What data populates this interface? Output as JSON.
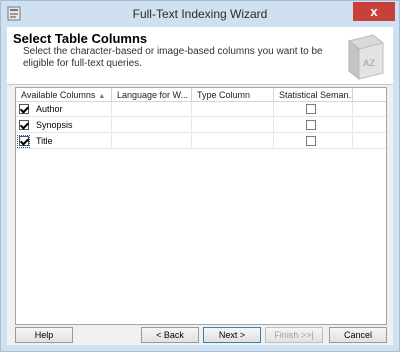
{
  "window": {
    "title": "Full-Text Indexing Wizard",
    "close_glyph": "x"
  },
  "header": {
    "title": "Select Table Columns",
    "subtitle": "Select the character-based or image-based columns you want to be eligible for full-text queries.",
    "graphic_letters": "AZ"
  },
  "grid": {
    "columns": [
      "Available Columns",
      "Language for W...",
      "Type Column",
      "Statistical Seman..."
    ],
    "sort_glyph": "▲",
    "rows": [
      {
        "name": "Author",
        "checked": true,
        "statistical": false
      },
      {
        "name": "Synopsis",
        "checked": true,
        "statistical": false
      },
      {
        "name": "Title",
        "checked": true,
        "statistical": false,
        "focused": true
      }
    ]
  },
  "buttons": {
    "help": "Help",
    "back": "< Back",
    "next": "Next >",
    "finish": "Finish >>|",
    "cancel": "Cancel"
  }
}
